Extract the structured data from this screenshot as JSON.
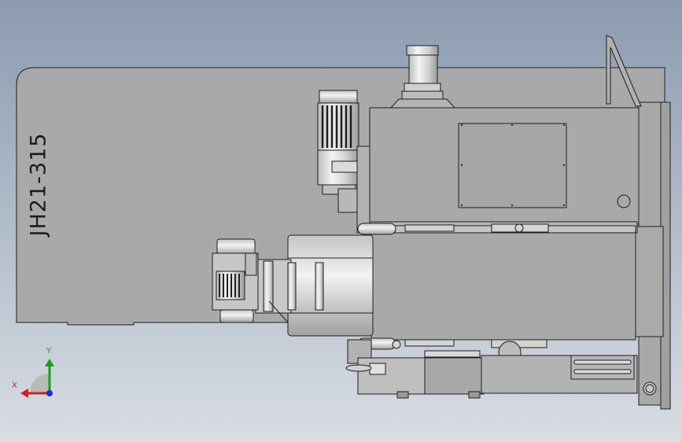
{
  "model": {
    "label": "JH21-315"
  },
  "triad": {
    "x_label": "X",
    "y_label": "Y",
    "x_color": "#d21f1f",
    "y_color": "#18a018",
    "z_color": "#1a2fd0"
  },
  "colors": {
    "body_fill": "#a8a8a8",
    "panel_fill": "#b6b6b6",
    "edge": "#1e1e1e",
    "metal_light": "#ececec"
  }
}
